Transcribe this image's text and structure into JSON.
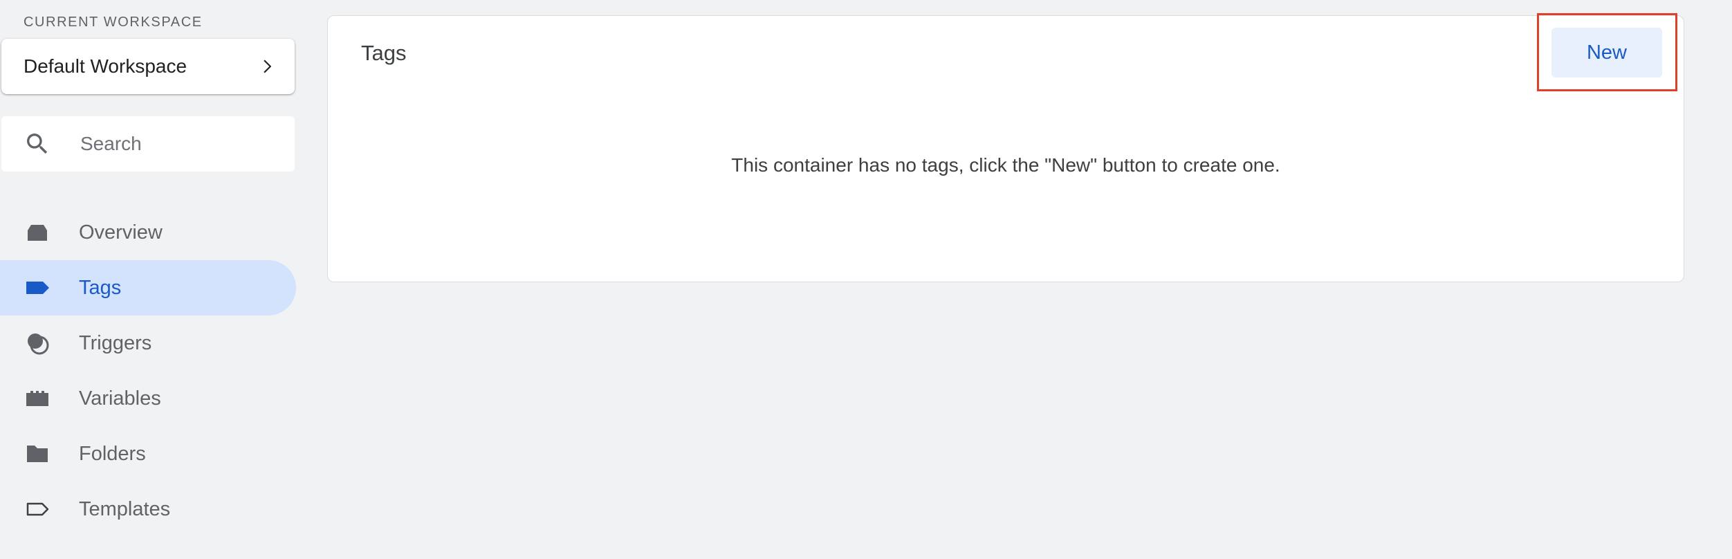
{
  "sidebar": {
    "workspace_label": "CURRENT WORKSPACE",
    "workspace_name": "Default Workspace",
    "search_placeholder": "Search",
    "nav_items": [
      {
        "label": "Overview",
        "icon": "overview-icon",
        "active": false
      },
      {
        "label": "Tags",
        "icon": "tag-icon",
        "active": true
      },
      {
        "label": "Triggers",
        "icon": "trigger-icon",
        "active": false
      },
      {
        "label": "Variables",
        "icon": "variables-icon",
        "active": false
      },
      {
        "label": "Folders",
        "icon": "folder-icon",
        "active": false
      },
      {
        "label": "Templates",
        "icon": "template-icon",
        "active": false
      }
    ]
  },
  "main": {
    "title": "Tags",
    "new_button_label": "New",
    "empty_message": "This container has no tags, click the \"New\" button to create one."
  },
  "colors": {
    "background": "#f1f2f4",
    "active_nav_bg": "#d3e3fd",
    "accent": "#1a5ac8",
    "highlight": "#e0402a"
  }
}
